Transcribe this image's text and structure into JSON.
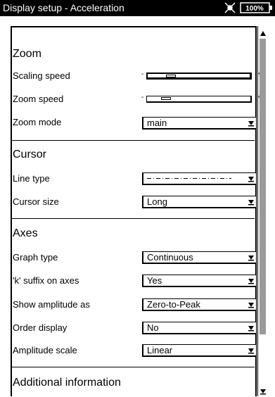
{
  "window": {
    "title": "Display setup - Acceleration",
    "status_icon": "fan-icon",
    "battery_label": "100%"
  },
  "sections": {
    "zoom": {
      "title": "Zoom",
      "scaling_speed_label": "Scaling speed",
      "scaling_speed_value": 0.2,
      "zoom_speed_label": "Zoom speed",
      "zoom_speed_value": 0.15,
      "zoom_mode_label": "Zoom mode",
      "zoom_mode_value": "main"
    },
    "cursor": {
      "title": "Cursor",
      "line_type_label": "Line type",
      "line_type_value": "dash-dot line",
      "cursor_size_label": "Cursor size",
      "cursor_size_value": "Long"
    },
    "axes": {
      "title": "Axes",
      "graph_type_label": "Graph type",
      "graph_type_value": "Continuous",
      "k_suffix_label": "'k' suffix on axes",
      "k_suffix_value": "Yes",
      "show_amplitude_label": "Show amplitude as",
      "show_amplitude_value": "Zero-to-Peak",
      "order_display_label": "Order display",
      "order_display_value": "No",
      "amplitude_scale_label": "Amplitude scale",
      "amplitude_scale_value": "Linear"
    },
    "additional": {
      "title": "Additional information"
    }
  },
  "slider_signs": {
    "minus": "-",
    "plus": "+"
  }
}
